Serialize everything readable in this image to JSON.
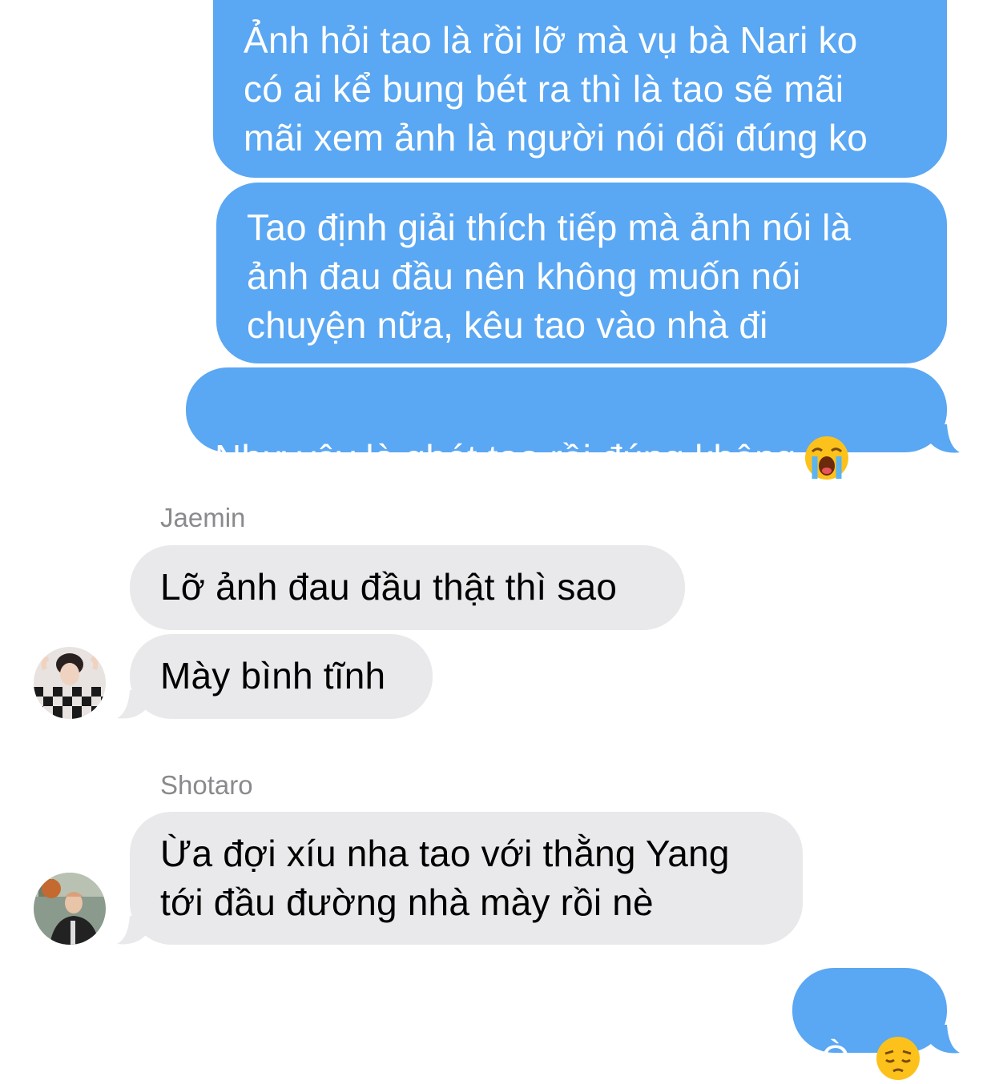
{
  "messages": [
    {
      "sender": "me",
      "text": "Ảnh hỏi tao là rồi lỡ mà vụ bà Nari ko\ncó ai kể bung bét ra thì là tao sẽ mãi\nmãi xem ảnh là người nói dối đúng ko"
    },
    {
      "sender": "me",
      "text": "Tao định giải thích tiếp mà ảnh nói là\nảnh đau đầu nên không muốn nói\nchuyện nữa, kêu tao vào nhà đi"
    },
    {
      "sender": "me",
      "text": "Như vậy là ghét tao rồi đúng không",
      "emoji": "loudly-crying-face-emoji"
    },
    {
      "sender": "Jaemin",
      "text": "Lỡ ảnh đau đầu thật thì sao"
    },
    {
      "sender": "Jaemin",
      "text": "Mày bình tĩnh"
    },
    {
      "sender": "Shotaro",
      "text": "Ừa đợi xíu nha tao với thằng Yang\ntới đầu đường nhà mày rồi nè"
    },
    {
      "sender": "me",
      "text": "Ò",
      "emoji": "pensive-face-emoji"
    }
  ],
  "names": {
    "jaemin": "Jaemin",
    "shotaro": "Shotaro"
  },
  "colors": {
    "sent_bubble": "#5aa7f3",
    "received_bubble": "#e9e9eb",
    "sender_name": "#8a8a8e"
  }
}
